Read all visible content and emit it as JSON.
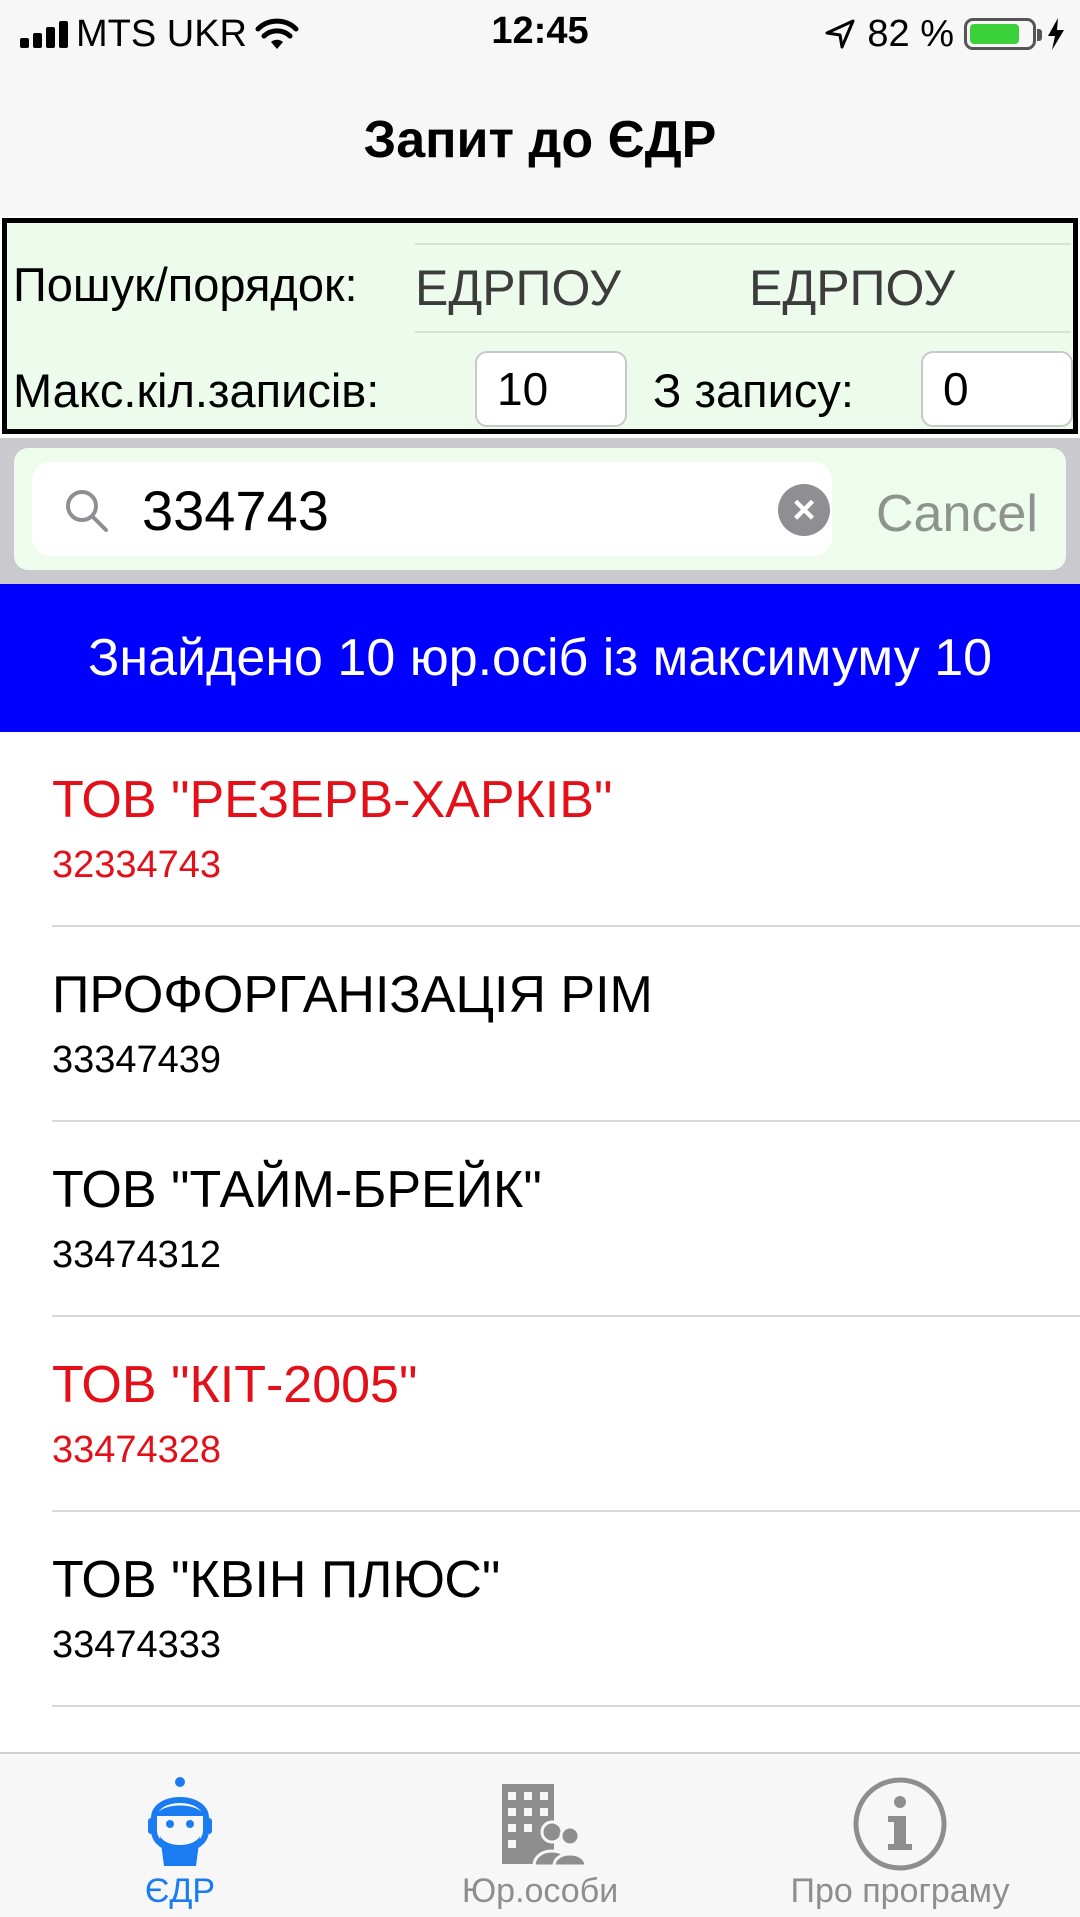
{
  "status_bar": {
    "carrier": "MTS UKR",
    "time": "12:45",
    "battery_percent": "82 %",
    "battery_level": 0.82,
    "icons": [
      "signal-icon",
      "wifi-icon",
      "location-arrow-icon",
      "battery-icon",
      "charging-bolt-icon"
    ]
  },
  "nav": {
    "title": "Запит до ЄДР"
  },
  "settings": {
    "search_order_label": "Пошук/порядок:",
    "search_by": "ЕДРПОУ",
    "order_by": "ЕДРПОУ",
    "max_records_label": "Макс.кіл.записів:",
    "max_records_value": "10",
    "from_record_label": "З запису:",
    "from_record_value": "0"
  },
  "search": {
    "query": "334743",
    "cancel_label": "Cancel",
    "icons": [
      "search-icon",
      "clear-icon"
    ]
  },
  "banner": {
    "text": "Знайдено 10 юр.осіб із максимуму 10"
  },
  "results": [
    {
      "name": "ТОВ \"РЕЗЕРВ-ХАРКІВ\"",
      "code": "32334743",
      "highlight": true
    },
    {
      "name": "ПРОФОРГАНІЗАЦІЯ РІМ",
      "code": "33347439",
      "highlight": false
    },
    {
      "name": "ТОВ \"ТАЙМ-БРЕЙК\"",
      "code": "33474312",
      "highlight": false
    },
    {
      "name": "ТОВ \"КІТ-2005\"",
      "code": "33474328",
      "highlight": true
    },
    {
      "name": "ТОВ \"КВІН ПЛЮС\"",
      "code": "33474333",
      "highlight": false
    }
  ],
  "tabs": [
    {
      "label": "ЄДР",
      "icon": "edr-person-icon",
      "active": true
    },
    {
      "label": "Юр.особи",
      "icon": "buildings-people-icon",
      "active": false
    },
    {
      "label": "Про програму",
      "icon": "info-icon",
      "active": false
    }
  ],
  "colors": {
    "banner_bg": "#0000ff",
    "highlight_text": "#e3101a",
    "active_tab": "#1a7cf0",
    "settings_bg": "#ecfbec"
  }
}
